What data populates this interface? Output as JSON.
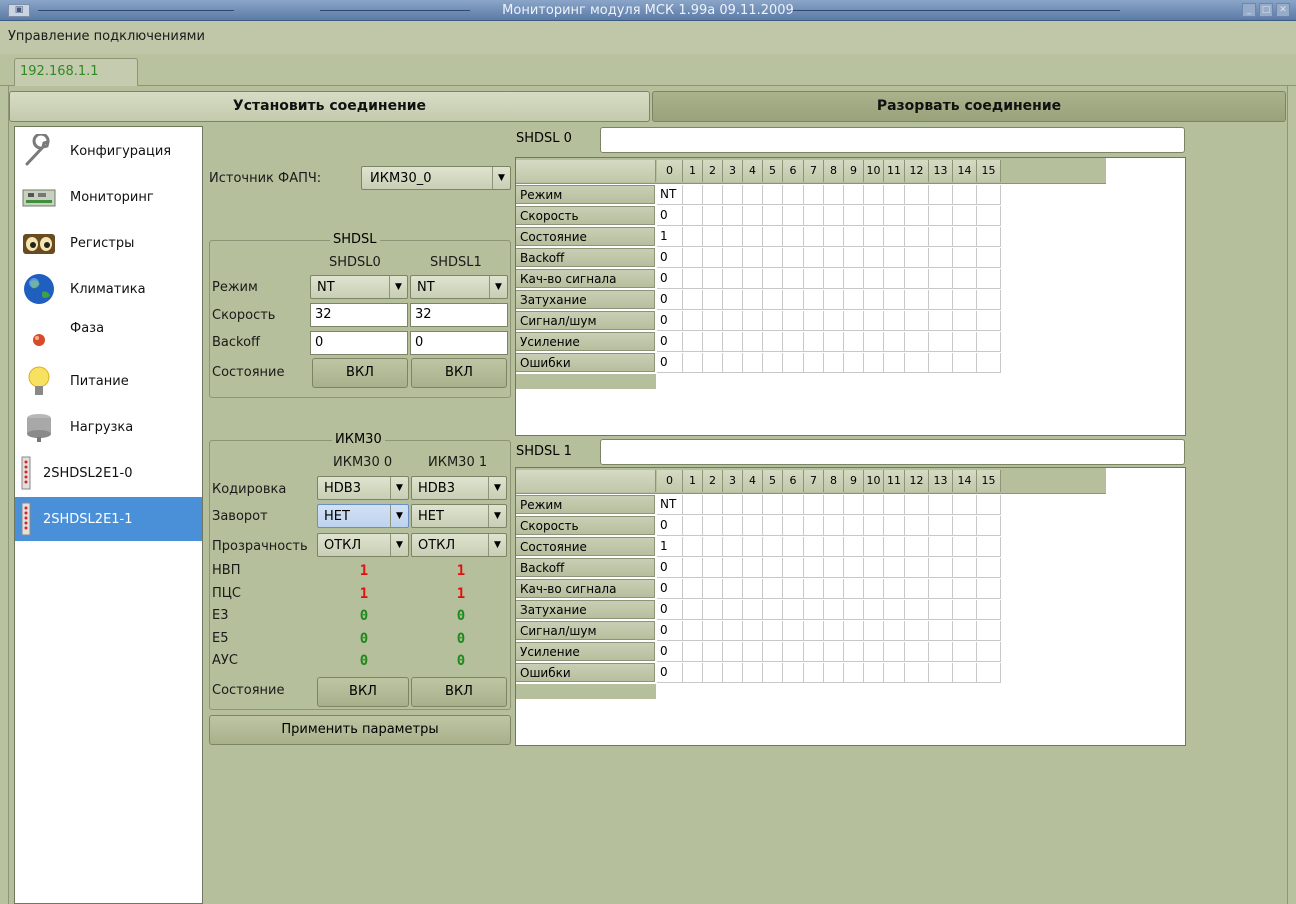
{
  "window": {
    "title": "Мониторинг модуля МСК 1.99а 09.11.2009",
    "sys_icon": "app-icon"
  },
  "menu": {
    "connection_mgmt": "Управление подключениями"
  },
  "tab": {
    "label": "192.168.1.1"
  },
  "buttons": {
    "connect": "Установить соединение",
    "disconnect": "Разорвать соединение",
    "apply": "Применить параметры"
  },
  "sidebar": {
    "items": [
      {
        "label": "Конфигурация",
        "icon": "wrench-icon"
      },
      {
        "label": "Мониторинг",
        "icon": "board-icon"
      },
      {
        "label": "Регистры",
        "icon": "eyes-icon"
      },
      {
        "label": "Климатика",
        "icon": "globe-icon"
      },
      {
        "label": "Фаза",
        "icon": "phase-icon"
      },
      {
        "label": "Питание",
        "icon": "bulb-icon"
      },
      {
        "label": "Нагрузка",
        "icon": "server-icon"
      },
      {
        "label": "2SHDSL2E1-0",
        "icon": "module-icon"
      },
      {
        "label": "2SHDSL2E1-1",
        "icon": "module-icon",
        "selected": true
      }
    ]
  },
  "pll": {
    "label": "Источник ФАПЧ:",
    "value": "ИКМ30_0"
  },
  "shdsl_group": {
    "title": "SHDSL",
    "col0": "SHDSL0",
    "col1": "SHDSL1",
    "rows": {
      "mode": "Режим",
      "speed": "Скорость",
      "backoff": "Backoff",
      "state": "Состояние"
    },
    "mode": [
      "NT",
      "NT"
    ],
    "speed": [
      "32",
      "32"
    ],
    "backoff": [
      "0",
      "0"
    ],
    "state": [
      "ВКЛ",
      "ВКЛ"
    ]
  },
  "ikm_group": {
    "title": "ИКМ30",
    "col0": "ИКМ30 0",
    "col1": "ИКМ30 1",
    "rows": {
      "coding": "Кодировка",
      "loop": "Заворот",
      "transparency": "Прозрачность",
      "nvp": "НВП",
      "pcs": "ПЦС",
      "e3": "E3",
      "e5": "E5",
      "ays": "АУС",
      "state": "Состояние"
    },
    "coding": [
      "HDB3",
      "HDB3"
    ],
    "loop": [
      "НЕТ",
      "НЕТ"
    ],
    "transparency": [
      "ОТКЛ",
      "ОТКЛ"
    ],
    "nvp": [
      "1",
      "1"
    ],
    "pcs": [
      "1",
      "1"
    ],
    "e3": [
      "0",
      "0"
    ],
    "e5": [
      "0",
      "0"
    ],
    "ays": [
      "0",
      "0"
    ],
    "state": [
      "ВКЛ",
      "ВКЛ"
    ]
  },
  "channels": [
    "0",
    "1",
    "2",
    "3",
    "4",
    "5",
    "6",
    "7",
    "8",
    "9",
    "10",
    "11",
    "12",
    "13",
    "14",
    "15"
  ],
  "table_rows": [
    "Режим",
    "Скорость",
    "Состояние",
    "Backoff",
    "Кач-во сигнала",
    "Затухание",
    "Сигнал/шум",
    "Усиление",
    "Ошибки"
  ],
  "shdsl0": {
    "label": "SHDSL 0",
    "first_col": [
      "NT",
      "0",
      "1",
      "0",
      "0",
      "0",
      "0",
      "0",
      "0"
    ]
  },
  "shdsl1": {
    "label": "SHDSL 1",
    "first_col": [
      "NT",
      "0",
      "1",
      "0",
      "0",
      "0",
      "0",
      "0",
      "0"
    ]
  },
  "colors": {
    "accent": "#4a90d9",
    "counter_red": "#e01010",
    "counter_green": "#1e8a1e",
    "bg": "#b6bf9b"
  }
}
